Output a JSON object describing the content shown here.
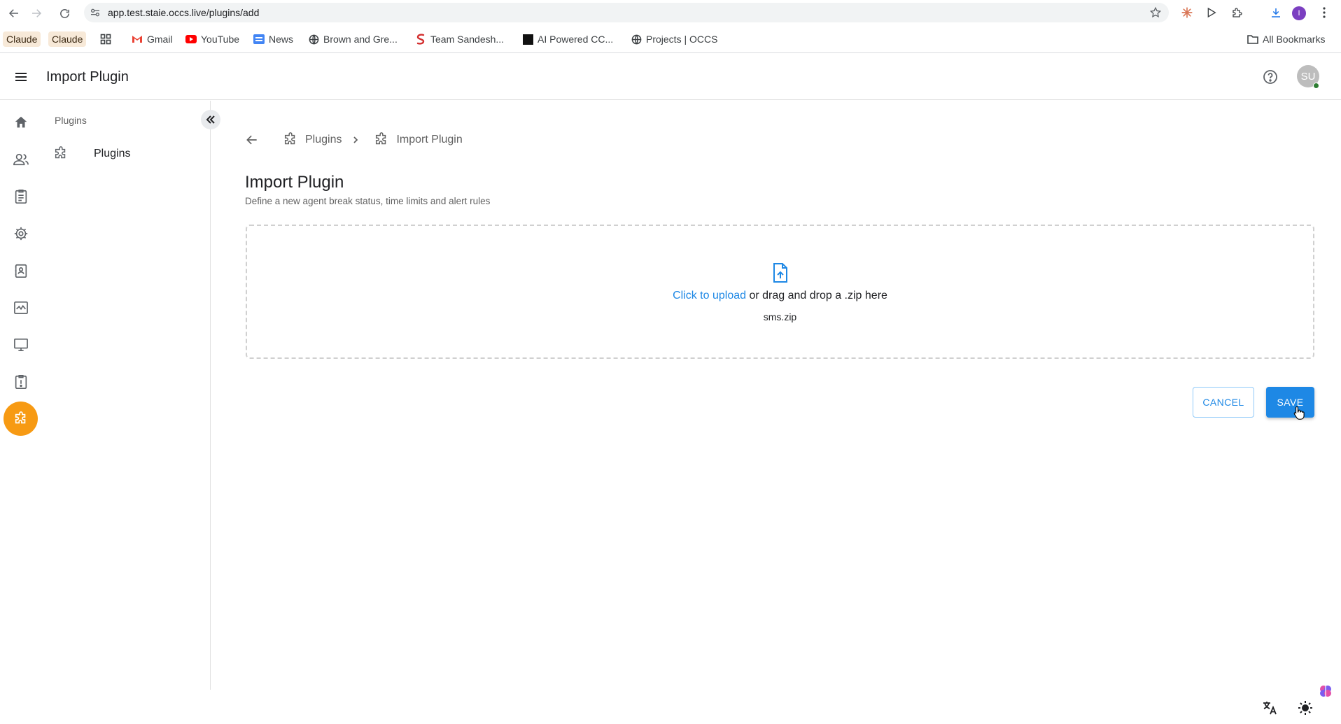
{
  "browser": {
    "url": "app.test.staie.occs.live/plugins/add",
    "profile_initial": "I",
    "bookmarks": [
      {
        "label": "Claude",
        "style": "chip"
      },
      {
        "label": "Claude",
        "style": "chip"
      },
      {
        "label": "",
        "icon": "apps-grid-icon"
      },
      {
        "label": "Gmail",
        "icon": "gmail-icon"
      },
      {
        "label": "YouTube",
        "icon": "youtube-icon"
      },
      {
        "label": "News",
        "icon": "news-icon"
      },
      {
        "label": "Brown and Gre...",
        "icon": "globe-icon"
      },
      {
        "label": "Team Sandesh...",
        "icon": "sandesh-icon"
      },
      {
        "label": "AI Powered CC...",
        "icon": "dark-square-icon"
      },
      {
        "label": "Projects | OCCS",
        "icon": "globe-icon"
      }
    ],
    "all_bookmarks_label": "All Bookmarks"
  },
  "header": {
    "title": "Import Plugin",
    "avatar_initials": "SU"
  },
  "side_panel": {
    "heading": "Plugins",
    "items": [
      {
        "label": "Plugins"
      }
    ]
  },
  "breadcrumb": {
    "items": [
      {
        "label": "Plugins"
      },
      {
        "label": "Import Plugin"
      }
    ]
  },
  "page": {
    "title": "Import Plugin",
    "subtitle": "Define a new agent break status, time limits and alert rules"
  },
  "upload": {
    "link_text": "Click to upload",
    "rest_text": " or drag and drop a .zip here",
    "file_name": "sms.zip"
  },
  "actions": {
    "cancel_label": "CANCEL",
    "save_label": "SAVE"
  },
  "colors": {
    "primary": "#1e88e5",
    "active_rail": "#f79a13",
    "online_dot": "#2e7d32"
  }
}
